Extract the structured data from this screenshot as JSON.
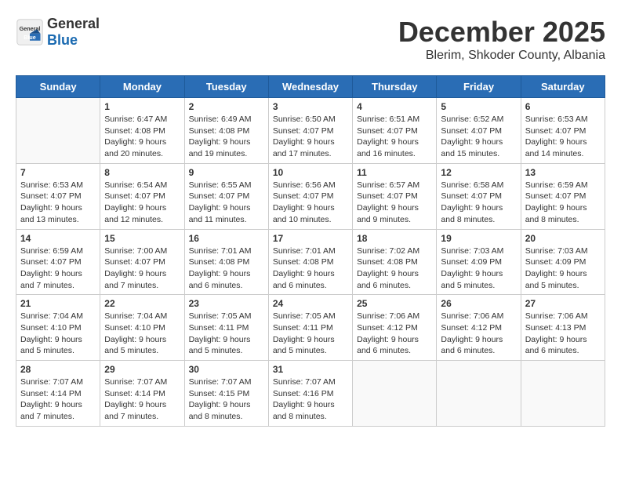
{
  "header": {
    "logo_general": "General",
    "logo_blue": "Blue",
    "month_title": "December 2025",
    "location": "Blerim, Shkoder County, Albania"
  },
  "days_of_week": [
    "Sunday",
    "Monday",
    "Tuesday",
    "Wednesday",
    "Thursday",
    "Friday",
    "Saturday"
  ],
  "weeks": [
    [
      {
        "day": "",
        "detail": ""
      },
      {
        "day": "1",
        "detail": "Sunrise: 6:47 AM\nSunset: 4:08 PM\nDaylight: 9 hours\nand 20 minutes."
      },
      {
        "day": "2",
        "detail": "Sunrise: 6:49 AM\nSunset: 4:08 PM\nDaylight: 9 hours\nand 19 minutes."
      },
      {
        "day": "3",
        "detail": "Sunrise: 6:50 AM\nSunset: 4:07 PM\nDaylight: 9 hours\nand 17 minutes."
      },
      {
        "day": "4",
        "detail": "Sunrise: 6:51 AM\nSunset: 4:07 PM\nDaylight: 9 hours\nand 16 minutes."
      },
      {
        "day": "5",
        "detail": "Sunrise: 6:52 AM\nSunset: 4:07 PM\nDaylight: 9 hours\nand 15 minutes."
      },
      {
        "day": "6",
        "detail": "Sunrise: 6:53 AM\nSunset: 4:07 PM\nDaylight: 9 hours\nand 14 minutes."
      }
    ],
    [
      {
        "day": "7",
        "detail": "Sunrise: 6:53 AM\nSunset: 4:07 PM\nDaylight: 9 hours\nand 13 minutes."
      },
      {
        "day": "8",
        "detail": "Sunrise: 6:54 AM\nSunset: 4:07 PM\nDaylight: 9 hours\nand 12 minutes."
      },
      {
        "day": "9",
        "detail": "Sunrise: 6:55 AM\nSunset: 4:07 PM\nDaylight: 9 hours\nand 11 minutes."
      },
      {
        "day": "10",
        "detail": "Sunrise: 6:56 AM\nSunset: 4:07 PM\nDaylight: 9 hours\nand 10 minutes."
      },
      {
        "day": "11",
        "detail": "Sunrise: 6:57 AM\nSunset: 4:07 PM\nDaylight: 9 hours\nand 9 minutes."
      },
      {
        "day": "12",
        "detail": "Sunrise: 6:58 AM\nSunset: 4:07 PM\nDaylight: 9 hours\nand 8 minutes."
      },
      {
        "day": "13",
        "detail": "Sunrise: 6:59 AM\nSunset: 4:07 PM\nDaylight: 9 hours\nand 8 minutes."
      }
    ],
    [
      {
        "day": "14",
        "detail": "Sunrise: 6:59 AM\nSunset: 4:07 PM\nDaylight: 9 hours\nand 7 minutes."
      },
      {
        "day": "15",
        "detail": "Sunrise: 7:00 AM\nSunset: 4:07 PM\nDaylight: 9 hours\nand 7 minutes."
      },
      {
        "day": "16",
        "detail": "Sunrise: 7:01 AM\nSunset: 4:08 PM\nDaylight: 9 hours\nand 6 minutes."
      },
      {
        "day": "17",
        "detail": "Sunrise: 7:01 AM\nSunset: 4:08 PM\nDaylight: 9 hours\nand 6 minutes."
      },
      {
        "day": "18",
        "detail": "Sunrise: 7:02 AM\nSunset: 4:08 PM\nDaylight: 9 hours\nand 6 minutes."
      },
      {
        "day": "19",
        "detail": "Sunrise: 7:03 AM\nSunset: 4:09 PM\nDaylight: 9 hours\nand 5 minutes."
      },
      {
        "day": "20",
        "detail": "Sunrise: 7:03 AM\nSunset: 4:09 PM\nDaylight: 9 hours\nand 5 minutes."
      }
    ],
    [
      {
        "day": "21",
        "detail": "Sunrise: 7:04 AM\nSunset: 4:10 PM\nDaylight: 9 hours\nand 5 minutes."
      },
      {
        "day": "22",
        "detail": "Sunrise: 7:04 AM\nSunset: 4:10 PM\nDaylight: 9 hours\nand 5 minutes."
      },
      {
        "day": "23",
        "detail": "Sunrise: 7:05 AM\nSunset: 4:11 PM\nDaylight: 9 hours\nand 5 minutes."
      },
      {
        "day": "24",
        "detail": "Sunrise: 7:05 AM\nSunset: 4:11 PM\nDaylight: 9 hours\nand 5 minutes."
      },
      {
        "day": "25",
        "detail": "Sunrise: 7:06 AM\nSunset: 4:12 PM\nDaylight: 9 hours\nand 6 minutes."
      },
      {
        "day": "26",
        "detail": "Sunrise: 7:06 AM\nSunset: 4:12 PM\nDaylight: 9 hours\nand 6 minutes."
      },
      {
        "day": "27",
        "detail": "Sunrise: 7:06 AM\nSunset: 4:13 PM\nDaylight: 9 hours\nand 6 minutes."
      }
    ],
    [
      {
        "day": "28",
        "detail": "Sunrise: 7:07 AM\nSunset: 4:14 PM\nDaylight: 9 hours\nand 7 minutes."
      },
      {
        "day": "29",
        "detail": "Sunrise: 7:07 AM\nSunset: 4:14 PM\nDaylight: 9 hours\nand 7 minutes."
      },
      {
        "day": "30",
        "detail": "Sunrise: 7:07 AM\nSunset: 4:15 PM\nDaylight: 9 hours\nand 8 minutes."
      },
      {
        "day": "31",
        "detail": "Sunrise: 7:07 AM\nSunset: 4:16 PM\nDaylight: 9 hours\nand 8 minutes."
      },
      {
        "day": "",
        "detail": ""
      },
      {
        "day": "",
        "detail": ""
      },
      {
        "day": "",
        "detail": ""
      }
    ]
  ]
}
